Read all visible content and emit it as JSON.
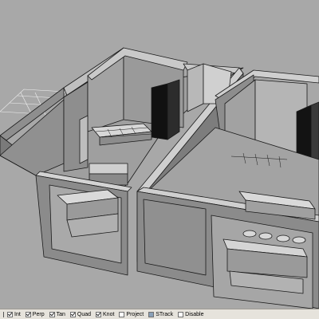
{
  "viewport": {
    "name": "perspective-viewport",
    "background": "#a8a8a8",
    "wall_color": "#8c8c8c",
    "edge_color": "#1a1a1a"
  },
  "statusbar": {
    "items": [
      {
        "label": "Int",
        "checked": true
      },
      {
        "label": "Perp",
        "checked": true
      },
      {
        "label": "Tan",
        "checked": true
      },
      {
        "label": "Quad",
        "checked": true
      },
      {
        "label": "Knot",
        "checked": true
      },
      {
        "label": "Project",
        "checked": false
      },
      {
        "label": "STrack",
        "checked": false,
        "filled": true
      },
      {
        "label": "Disable",
        "checked": false
      }
    ]
  }
}
